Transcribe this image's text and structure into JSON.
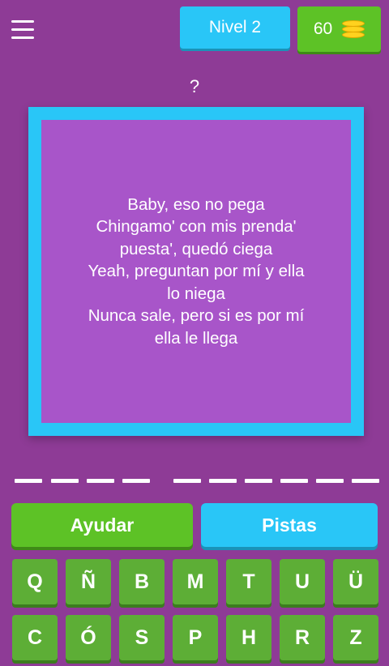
{
  "header": {
    "level_label": "Nivel 2",
    "coins": "60",
    "menu_icon": "hamburger-menu-icon",
    "coin_icon": "coin-stack-icon"
  },
  "question": {
    "mark": "?",
    "lyrics": [
      "Baby, eso no pega",
      "Chingamo' con mis prenda'",
      "puesta', quedó ciega",
      "Yeah, preguntan por mí y ella",
      "lo niega",
      "Nunca sale, pero si es por mí",
      "ella le llega"
    ]
  },
  "answer": {
    "word_lengths": [
      4,
      6
    ],
    "filled": ""
  },
  "actions": {
    "help_label": "Ayudar",
    "hints_label": "Pistas"
  },
  "keyboard": {
    "row1": [
      "Q",
      "Ñ",
      "B",
      "M",
      "T",
      "U",
      "Ü"
    ],
    "row2": [
      "C",
      "Ó",
      "S",
      "P",
      "H",
      "R",
      "Z"
    ]
  },
  "colors": {
    "background": "#8e3b96",
    "accent_blue": "#29c6f7",
    "accent_green": "#5dc226",
    "card_inner": "#a855c9",
    "key_green": "#5dae36"
  }
}
